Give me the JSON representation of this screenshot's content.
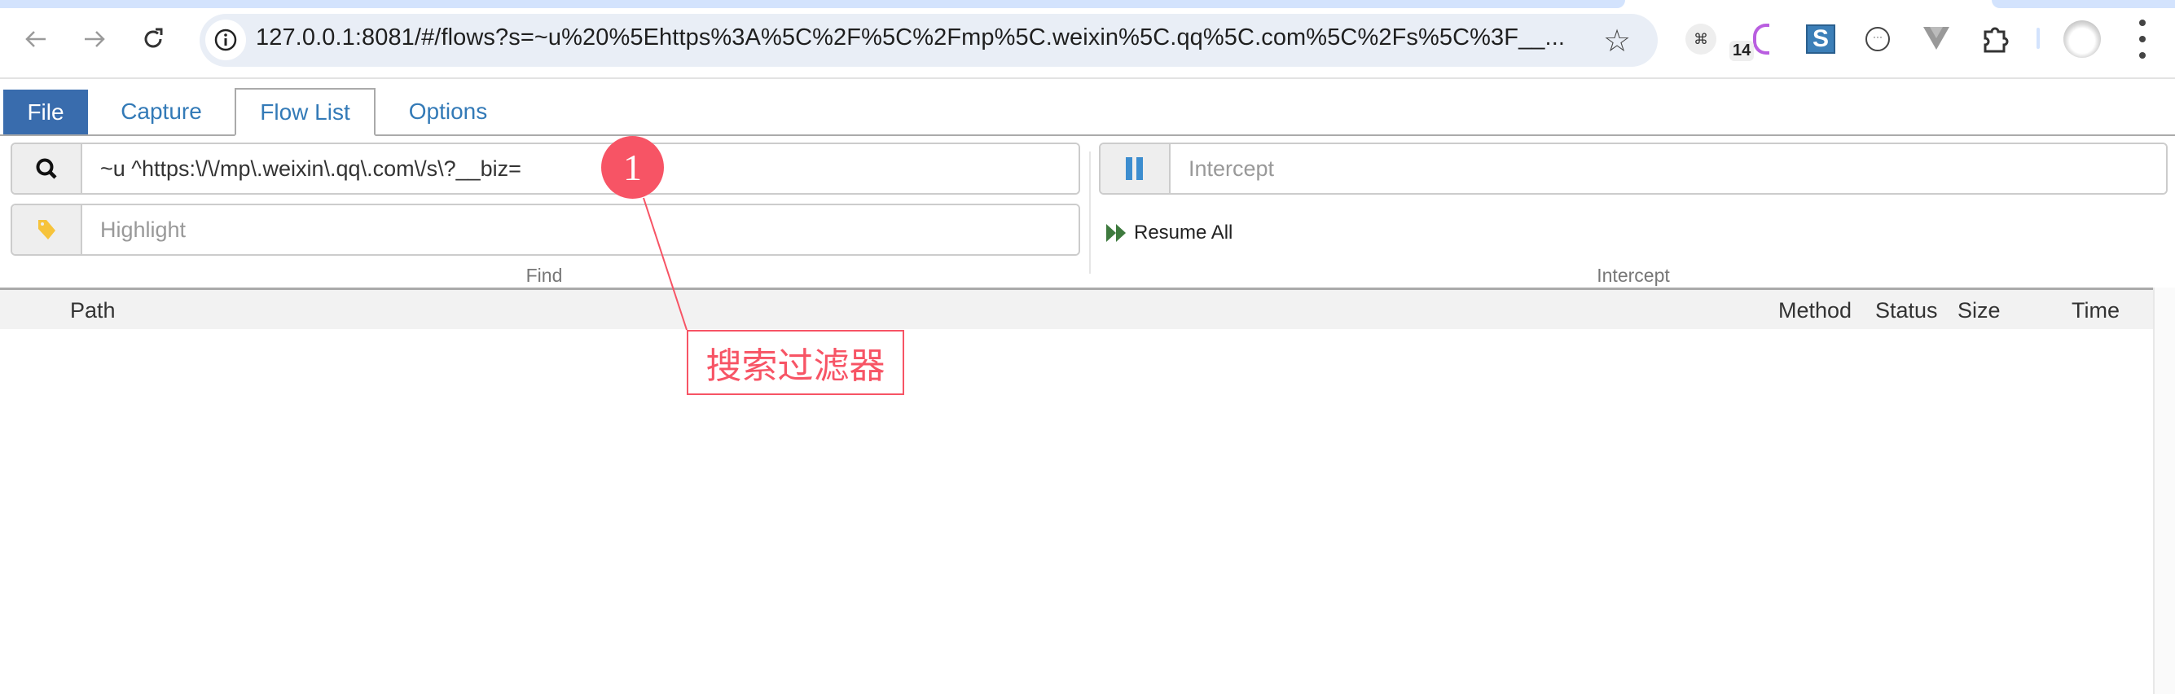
{
  "browser": {
    "url": "127.0.0.1:8081/#/flows?s=~u%20%5Ehttps%3A%5C%2F%5C%2Fmp%5C.weixin%5C.qq%5C.com%5C%2Fs%5C%3F__...",
    "extensions": [
      {
        "name": "qr-code-extension-icon"
      },
      {
        "name": "purple-extension-icon",
        "badge": "14"
      },
      {
        "name": "s-extension-icon"
      },
      {
        "name": "chat-extension-icon"
      },
      {
        "name": "vue-devtools-icon"
      },
      {
        "name": "extensions-puzzle-icon"
      }
    ]
  },
  "app_tabs": [
    {
      "label": "File",
      "active": false
    },
    {
      "label": "Capture",
      "active": false
    },
    {
      "label": "Flow List",
      "active": true
    },
    {
      "label": "Options",
      "active": false
    }
  ],
  "find": {
    "search_value": "~u ^https:\\/\\/mp\\.weixin\\.qq\\.com\\/s\\?__biz=",
    "highlight_placeholder": "Highlight",
    "group_label": "Find"
  },
  "intercept": {
    "placeholder": "Intercept",
    "resume_all_label": "Resume All",
    "group_label": "Intercept"
  },
  "table": {
    "columns": [
      "Path",
      "Method",
      "Status",
      "Size",
      "Time"
    ],
    "rows": []
  },
  "annotation": {
    "number": "1",
    "label": "搜索过滤器",
    "color": "#f75465"
  },
  "colors": {
    "file_tab_bg": "#396cad",
    "tab_text": "#337ab7",
    "pause_icon": "#3c8dcf",
    "resume_icon": "#3e7a3e",
    "highlight_icon": "#f6c33b"
  }
}
